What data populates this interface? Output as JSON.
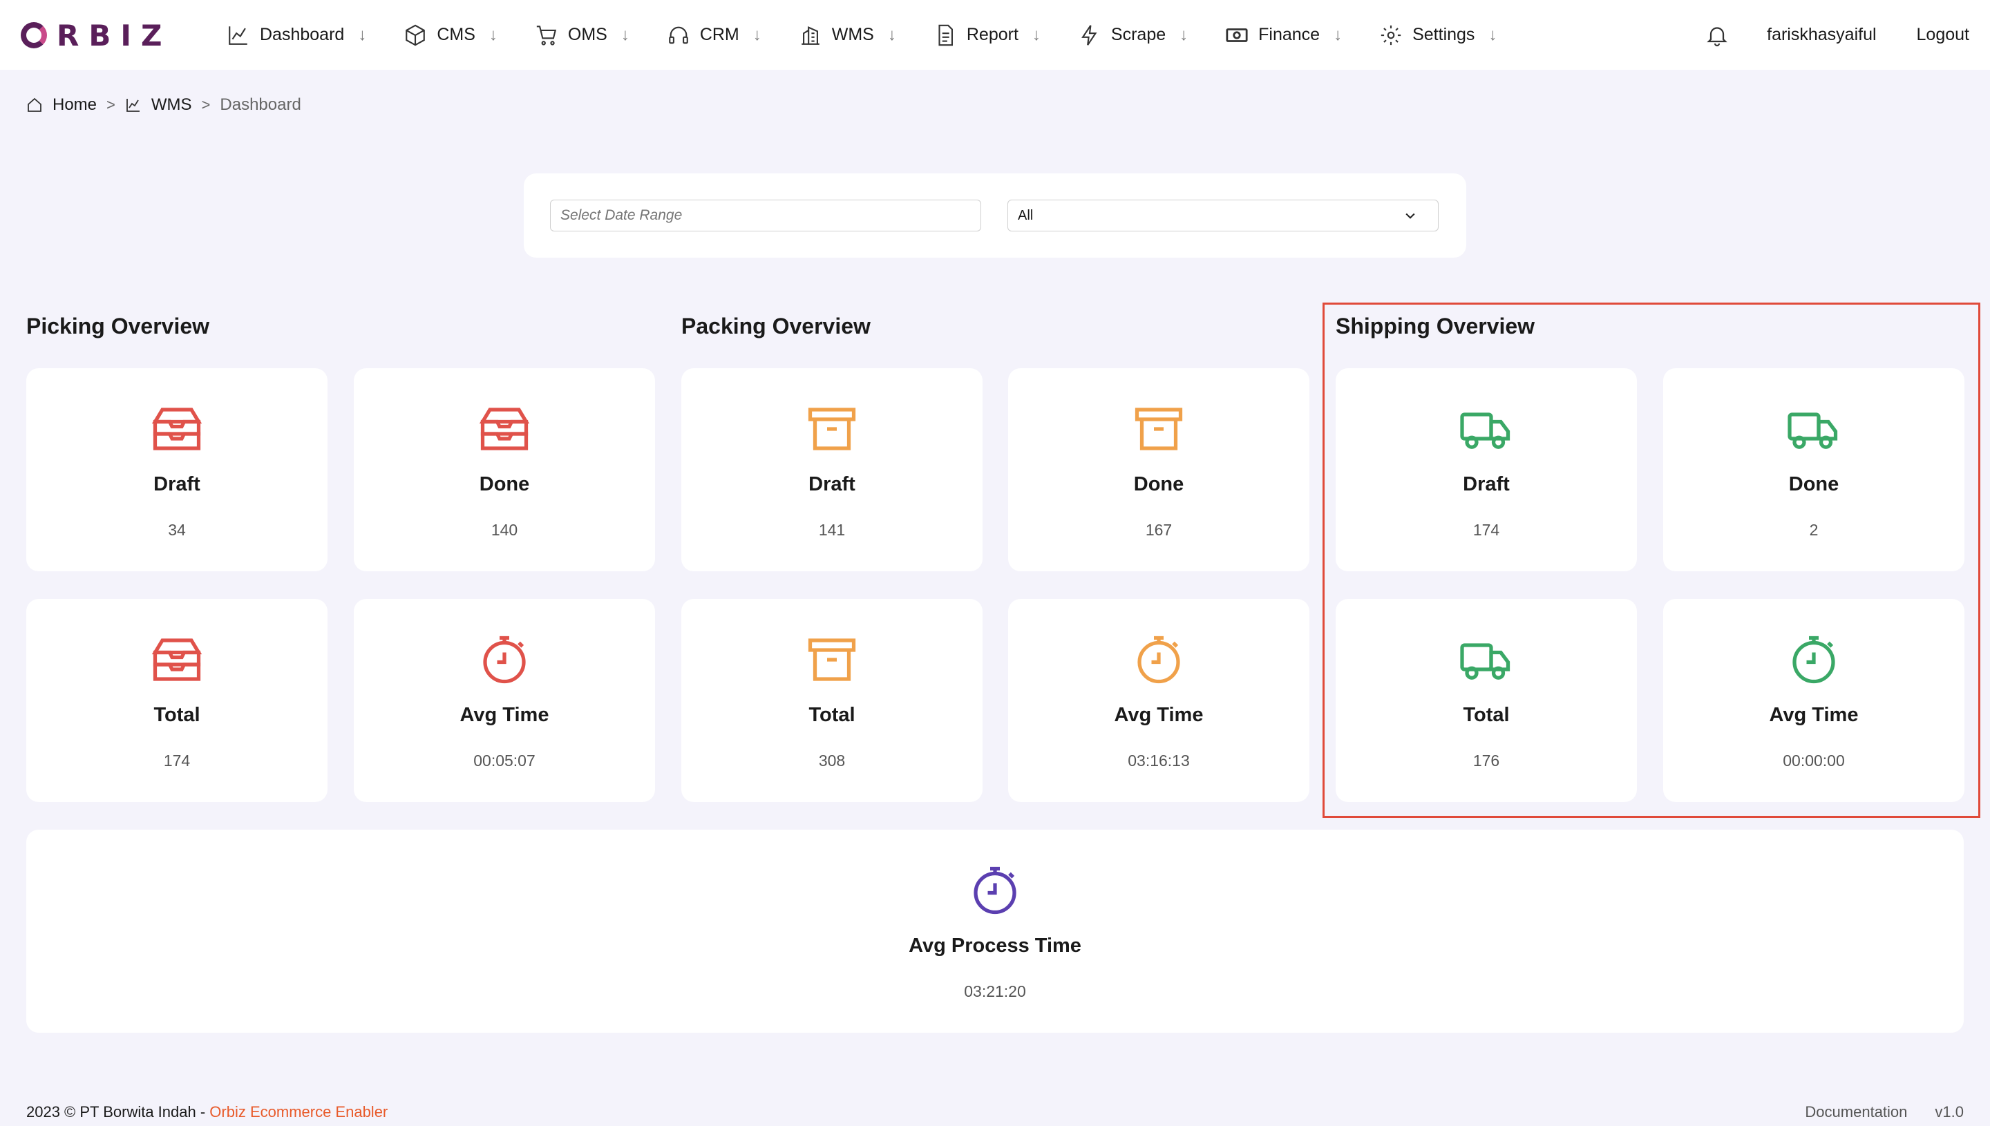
{
  "logo": "RBIZ",
  "nav": {
    "items": [
      {
        "label": "Dashboard",
        "icon": "chart-line-icon"
      },
      {
        "label": "CMS",
        "icon": "cube-icon"
      },
      {
        "label": "OMS",
        "icon": "cart-icon"
      },
      {
        "label": "CRM",
        "icon": "headset-icon"
      },
      {
        "label": "WMS",
        "icon": "building-icon"
      },
      {
        "label": "Report",
        "icon": "document-icon"
      },
      {
        "label": "Scrape",
        "icon": "bolt-icon"
      },
      {
        "label": "Finance",
        "icon": "cash-icon"
      },
      {
        "label": "Settings",
        "icon": "gear-icon"
      }
    ],
    "arrow": "↓",
    "user": "fariskhasyaiful",
    "logout": "Logout"
  },
  "breadcrumb": {
    "home": "Home",
    "wms": "WMS",
    "current": "Dashboard",
    "sep": ">"
  },
  "filter": {
    "date_placeholder": "Select Date Range",
    "select_value": "All"
  },
  "picking": {
    "title": "Picking Overview",
    "color": "#e0524a",
    "draft": {
      "label": "Draft",
      "value": "34"
    },
    "done": {
      "label": "Done",
      "value": "140"
    },
    "total": {
      "label": "Total",
      "value": "174"
    },
    "avg": {
      "label": "Avg Time",
      "value": "00:05:07"
    }
  },
  "packing": {
    "title": "Packing Overview",
    "color": "#f0a14a",
    "draft": {
      "label": "Draft",
      "value": "141"
    },
    "done": {
      "label": "Done",
      "value": "167"
    },
    "total": {
      "label": "Total",
      "value": "308"
    },
    "avg": {
      "label": "Avg Time",
      "value": "03:16:13"
    }
  },
  "shipping": {
    "title": "Shipping Overview",
    "color": "#3aa866",
    "draft": {
      "label": "Draft",
      "value": "174"
    },
    "done": {
      "label": "Done",
      "value": "2"
    },
    "total": {
      "label": "Total",
      "value": "176"
    },
    "avg": {
      "label": "Avg Time",
      "value": "00:00:00"
    }
  },
  "process": {
    "label": "Avg Process Time",
    "value": "03:21:20",
    "color": "#5b3fb0"
  },
  "footer": {
    "copyright": "2023 © PT Borwita Indah - ",
    "brand": "Orbiz Ecommerce Enabler",
    "documentation": "Documentation",
    "version": "v1.0"
  }
}
